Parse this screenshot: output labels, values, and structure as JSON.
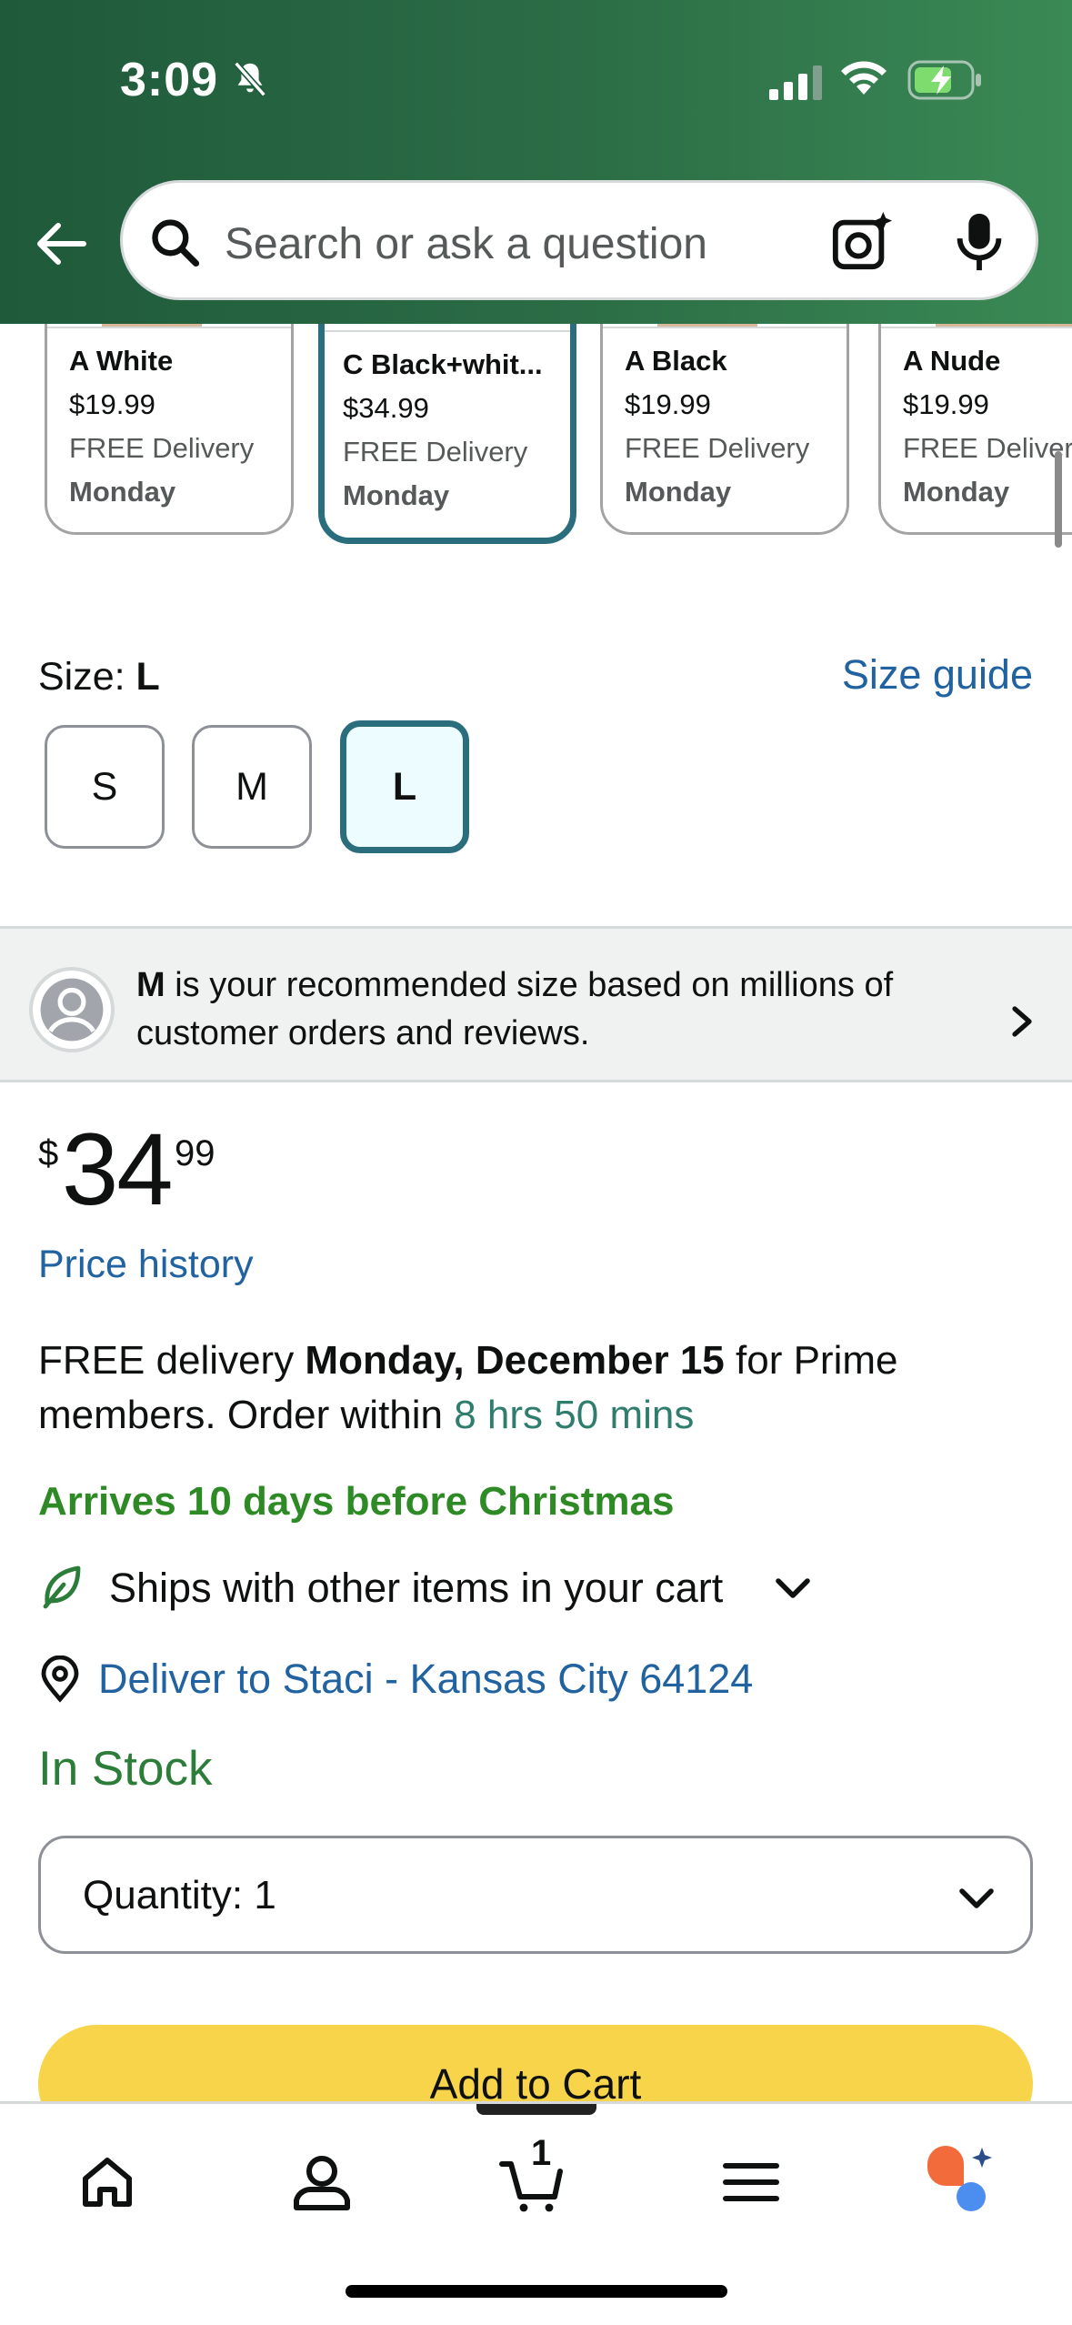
{
  "status_bar": {
    "time": "3:09"
  },
  "search": {
    "placeholder": "Search or ask a question"
  },
  "variants": [
    {
      "name": "A White",
      "price": "$19.99",
      "delivery": "FREE Delivery",
      "day": "Monday"
    },
    {
      "name": "C Black+whit...",
      "price": "$34.99",
      "delivery": "FREE Delivery",
      "day": "Monday",
      "selected": true
    },
    {
      "name": "A Black",
      "price": "$19.99",
      "delivery": "FREE Delivery",
      "day": "Monday"
    },
    {
      "name": "A Nude",
      "price": "$19.99",
      "delivery": "FREE Delivery",
      "day": "Monday"
    }
  ],
  "size": {
    "label": "Size: ",
    "selected": "L",
    "guide_link": "Size guide",
    "options": [
      "S",
      "M",
      "L"
    ]
  },
  "recommendation": {
    "size": "M",
    "text": " is your recommended size based on millions of customer orders and reviews."
  },
  "price": {
    "symbol": "$",
    "whole": "34",
    "fraction": "99"
  },
  "price_history": "Price history",
  "delivery": {
    "prefix": "FREE delivery ",
    "date": "Monday, December 15",
    "middle": " for Prime members. Order within ",
    "countdown": "8 hrs 50 mins"
  },
  "arrives": "Arrives 10 days before Christmas",
  "ships_with": "Ships with other items in your cart",
  "deliver_to": "Deliver to Staci - Kansas City 64124",
  "stock": "In Stock",
  "quantity": {
    "label": "Quantity:",
    "value": "1"
  },
  "add_to_cart": "Add to Cart",
  "bottom_nav": {
    "cart_count": "1"
  },
  "colors": {
    "header": "#2c6d46",
    "link": "#2162a1",
    "selected_border": "#2a6e7e",
    "in_stock": "#2d7d3a",
    "arrives": "#2d8a25",
    "add_to_cart": "#f7d44a"
  }
}
